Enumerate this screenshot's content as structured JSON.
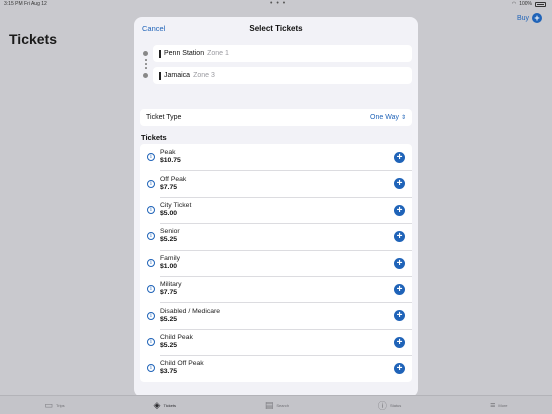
{
  "status_bar": {
    "time": "3:15 PM  Fri Aug 12",
    "dots": "• • •",
    "battery": "100%"
  },
  "page": {
    "title": "Tickets",
    "buy_label": "Buy"
  },
  "tabs": [
    {
      "label": "Trips",
      "icon": "ticket-icon"
    },
    {
      "label": "Tickets",
      "icon": "tickets-icon"
    },
    {
      "label": "Search",
      "icon": "map-icon"
    },
    {
      "label": "Status",
      "icon": "info-icon"
    },
    {
      "label": "More",
      "icon": "menu-icon"
    }
  ],
  "modal": {
    "cancel_label": "Cancel",
    "title": "Select Tickets",
    "origin": {
      "name": "Penn Station",
      "zone": "Zone 1"
    },
    "destination": {
      "name": "Jamaica",
      "zone": "Zone 3"
    },
    "ticket_type": {
      "label": "Ticket Type",
      "value": "One Way"
    },
    "section_title": "Tickets",
    "tickets": [
      {
        "name": "Peak",
        "price": "$10.75"
      },
      {
        "name": "Off Peak",
        "price": "$7.75"
      },
      {
        "name": "City Ticket",
        "price": "$5.00"
      },
      {
        "name": "Senior",
        "price": "$5.25"
      },
      {
        "name": "Family",
        "price": "$1.00"
      },
      {
        "name": "Military",
        "price": "$7.75"
      },
      {
        "name": "Disabled / Medicare",
        "price": "$5.25"
      },
      {
        "name": "Child Peak",
        "price": "$5.25"
      },
      {
        "name": "Child Off Peak",
        "price": "$3.75"
      }
    ]
  },
  "colors": {
    "accent": "#1f63b8",
    "background": "#c9c9ce",
    "sheet": "#f2f2f7"
  }
}
